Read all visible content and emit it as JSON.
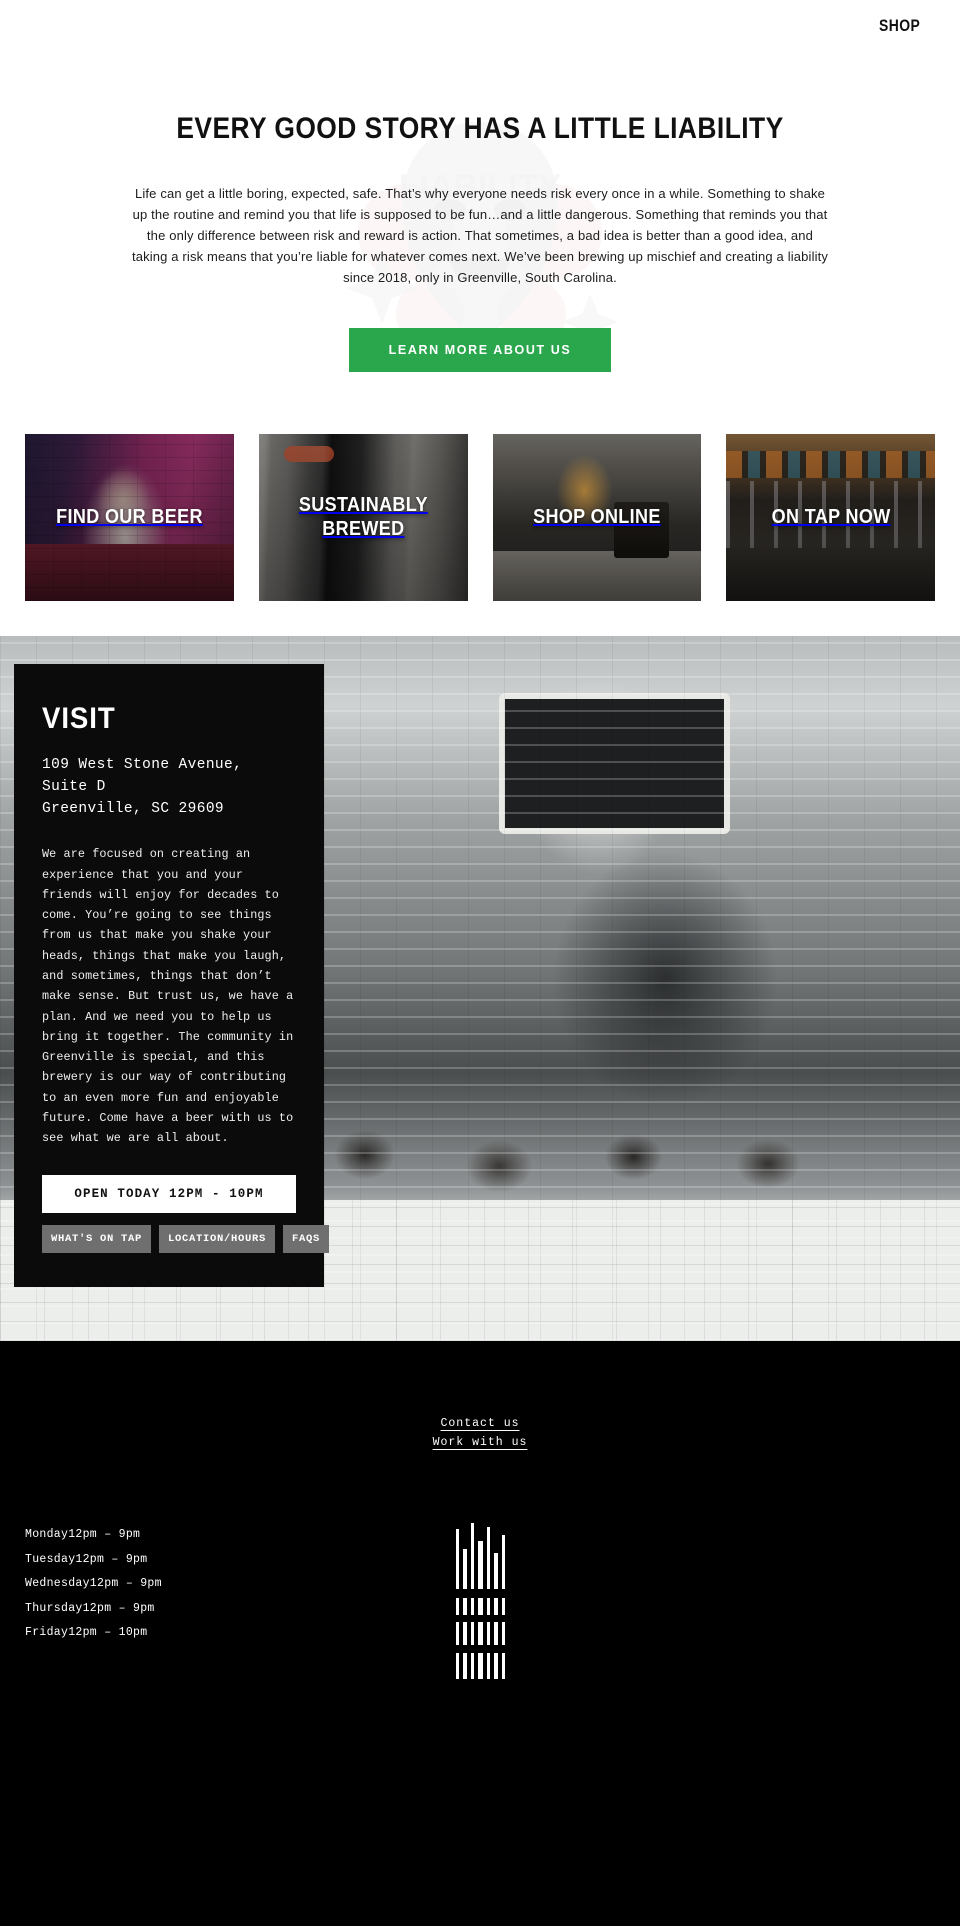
{
  "header": {
    "shop_label": "SHOP"
  },
  "hero": {
    "title": "EVERY GOOD STORY HAS A LITTLE LIABILITY",
    "paragraph": "Life can get a little boring, expected, safe. That’s why everyone needs risk every once in a while.  Something to shake up the routine and remind you that life is supposed to be fun…and a little dangerous. Something that reminds you that the only difference between risk and reward is action. That sometimes, a bad idea is better than a good idea, and taking a risk means that you’re liable for whatever comes next. We’ve been brewing up mischief and creating a liability since 2018, only in Greenville, South Carolina.",
    "cta_label": "LEARN MORE ABOUT US",
    "cta_color": "#2aa74d"
  },
  "cards": [
    {
      "label": "FIND OUR BEER"
    },
    {
      "label": "SUSTAINABLY BREWED"
    },
    {
      "label": "SHOP ONLINE"
    },
    {
      "label": "ON TAP NOW"
    }
  ],
  "visit": {
    "title": "VISIT",
    "address_line1": "109 West Stone Avenue, Suite D",
    "address_line2": "Greenville, SC 29609",
    "body": "We are focused on creating an experience that you and your friends will enjoy for decades to come. You’re going to see things from us that make you shake your heads, things that make you laugh, and sometimes, things that don’t make sense. But trust us, we have a plan. And we need you to help us bring it together. The community in Greenville is special, and this brewery is our way of contributing to an even more fun and enjoyable future. Come have a beer with us to see what we are all about.",
    "open_today": "OPEN TODAY 12PM - 10PM",
    "links": [
      {
        "label": "WHAT'S ON TAP"
      },
      {
        "label": "LOCATION/HOURS"
      },
      {
        "label": "FAQS"
      }
    ]
  },
  "footer": {
    "links": [
      {
        "label": "Contact us"
      },
      {
        "label": "Work with us"
      }
    ],
    "hours": [
      {
        "text": "Monday12pm – 9pm"
      },
      {
        "text": "Tuesday12pm – 9pm"
      },
      {
        "text": "Wednesday12pm – 9pm"
      },
      {
        "text": "Thursday12pm – 9pm"
      },
      {
        "text": "Friday12pm – 10pm"
      }
    ]
  }
}
